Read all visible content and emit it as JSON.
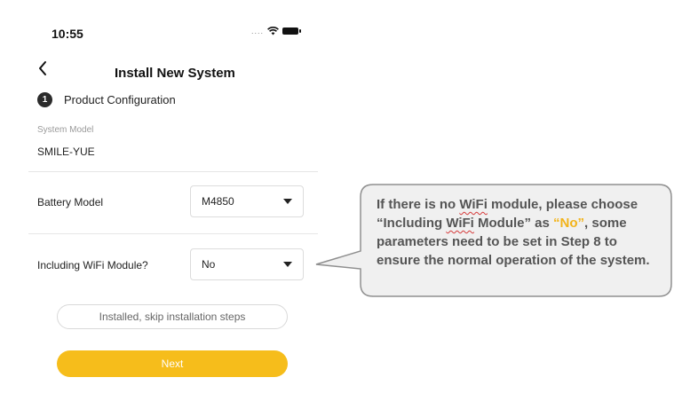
{
  "status_bar": {
    "time": "10:55",
    "signal": "....",
    "icons": [
      "wifi-icon",
      "battery-icon"
    ]
  },
  "header": {
    "title": "Install New System",
    "back_icon": "chevron-left-icon"
  },
  "step": {
    "number": "1",
    "label": "Product Configuration"
  },
  "system_model": {
    "label": "System Model",
    "value": "SMILE-YUE"
  },
  "battery_model": {
    "label": "Battery Model",
    "selected": "M4850"
  },
  "wifi_module": {
    "label": "Including WiFi Module?",
    "selected": "No"
  },
  "buttons": {
    "skip_label": "Installed, skip installation steps",
    "next_label": "Next"
  },
  "callout": {
    "part1": "If there is no ",
    "wifi1": "WiFi",
    "part2": " module, please choose “Including ",
    "wifi2": "WiFi",
    "part3": " Module” as ",
    "highlight": "“No”",
    "part4": ", some parameters need to be set in Step 8 to ensure the normal operation of the system."
  },
  "colors": {
    "accent": "#f6bd1b",
    "highlight": "#f2b319",
    "callout_bg": "#f0f0f0",
    "callout_border": "#8f8f8f"
  }
}
